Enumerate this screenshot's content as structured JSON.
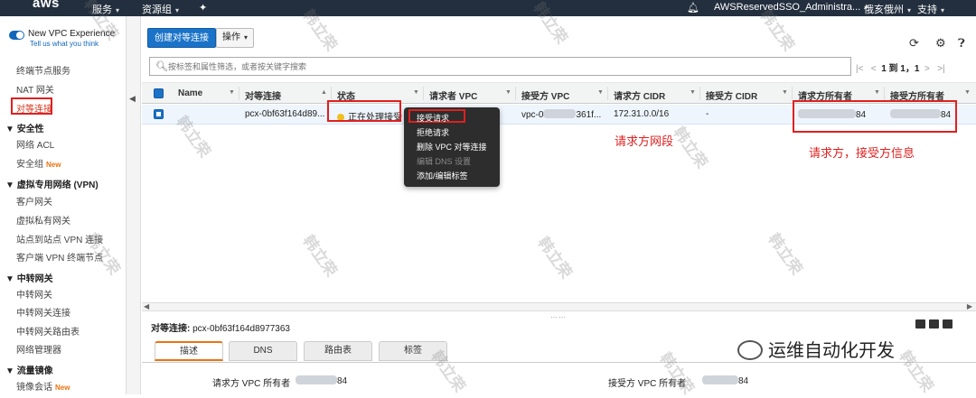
{
  "topnav": {
    "logo": "aws",
    "services": "服务",
    "resource_groups": "资源组",
    "account": "AWSReservedSSO_Administra...",
    "region": "俄亥俄州",
    "support": "支持"
  },
  "sidebar": {
    "toggle_title": "New VPC Experience",
    "toggle_link": "Tell us what you think",
    "items_top": [
      {
        "label": "终端节点服务"
      },
      {
        "label": "NAT 网关"
      },
      {
        "label": "对等连接",
        "active": true
      }
    ],
    "groups": [
      {
        "title": "安全性",
        "items": [
          {
            "label": "网络 ACL"
          },
          {
            "label": "安全组",
            "badge": "New"
          }
        ]
      },
      {
        "title": "虚拟专用网络 (VPN)",
        "items": [
          {
            "label": "客户网关"
          },
          {
            "label": "虚拟私有网关"
          },
          {
            "label": "站点到站点 VPN 连接"
          },
          {
            "label": "客户端 VPN 终端节点"
          }
        ]
      },
      {
        "title": "中转网关",
        "items": [
          {
            "label": "中转网关"
          },
          {
            "label": "中转网关连接"
          },
          {
            "label": "中转网关路由表"
          },
          {
            "label": "网络管理器"
          }
        ]
      },
      {
        "title": "流量镜像",
        "items": [
          {
            "label": "镜像会话",
            "badge": "New"
          }
        ]
      }
    ]
  },
  "toolbar": {
    "create_button": "创建对等连接",
    "actions_button": "操作"
  },
  "search": {
    "placeholder": "按标签和属性筛选，或者按关键字搜索"
  },
  "pager": {
    "range": "1 到 1，1"
  },
  "table": {
    "columns": [
      "Name",
      "对等连接",
      "状态",
      "请求者 VPC",
      "接受方 VPC",
      "请求方 CIDR",
      "接受方 CIDR",
      "请求方所有者",
      "接受方所有者"
    ],
    "rows": [
      {
        "name": "",
        "peering_id": "pcx-0bf63f164d89...",
        "status": "正在处理接受",
        "requester_vpc": "",
        "accepter_vpc_prefix": "vpc-0",
        "accepter_vpc_suffix": "361f...",
        "requester_cidr": "172.31.0.0/16",
        "accepter_cidr": "-",
        "requester_owner_suffix": "84",
        "accepter_owner_suffix": "84"
      }
    ]
  },
  "context_menu": {
    "items": [
      {
        "label": "接受请求",
        "disabled": false
      },
      {
        "label": "拒绝请求",
        "disabled": false
      },
      {
        "label": "删除 VPC 对等连接",
        "disabled": false
      },
      {
        "label": "编辑 DNS 设置",
        "disabled": true
      },
      {
        "label": "添加/编辑标签",
        "disabled": false
      }
    ]
  },
  "annotations": {
    "requester_cidr": "请求方网段",
    "owner_info": "请求方，接受方信息"
  },
  "detail": {
    "title_label": "对等连接:",
    "title_value": "pcx-0bf63f164d8977363",
    "tabs": [
      "描述",
      "DNS",
      "路由表",
      "标签"
    ],
    "requester_owner_label": "请求方 VPC 所有者",
    "requester_owner_value": "84",
    "accepter_owner_label": "接受方 VPC 所有者",
    "accepter_owner_value": "84"
  },
  "watermark": "韩立荣",
  "brand_mark": "运维自动化开发",
  "colors": {
    "nav_bg": "#232f3e",
    "primary": "#1a73c8",
    "annotation_red": "#e02020",
    "tab_accent": "#ec7211"
  }
}
